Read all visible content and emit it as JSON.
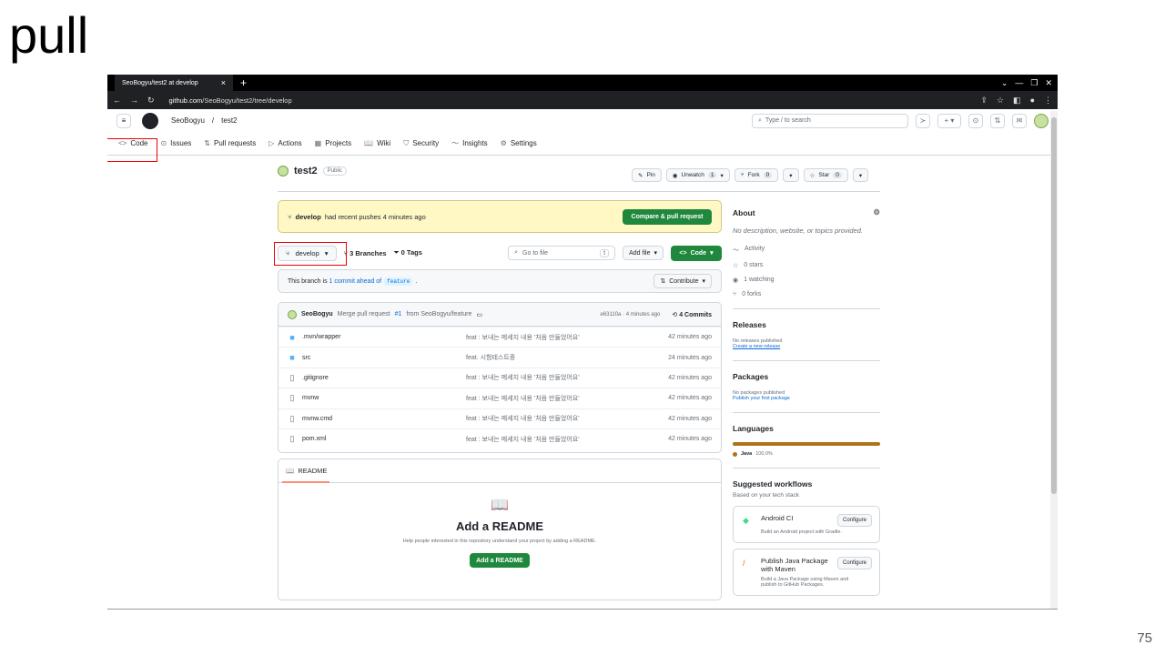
{
  "slide": {
    "title": "pull",
    "page": "75"
  },
  "browser": {
    "tab_title": "SeoBogyu/test2 at develop",
    "tab_close": "×",
    "new_tab": "+",
    "url_host": "github.com",
    "url_path": "/SeoBogyu/test2/tree/develop"
  },
  "header": {
    "owner": "SeoBogyu",
    "sep": "/",
    "repo": "test2",
    "search_placeholder": "Type / to search"
  },
  "tabs": [
    {
      "label": "Code",
      "icon": "<>"
    },
    {
      "label": "Issues",
      "icon": "⊙"
    },
    {
      "label": "Pull requests",
      "icon": "⇅"
    },
    {
      "label": "Actions",
      "icon": "▷"
    },
    {
      "label": "Projects",
      "icon": "▦"
    },
    {
      "label": "Wiki",
      "icon": "📖"
    },
    {
      "label": "Security",
      "icon": "⛉"
    },
    {
      "label": "Insights",
      "icon": "〜"
    },
    {
      "label": "Settings",
      "icon": "⚙"
    }
  ],
  "repo": {
    "name": "test2",
    "visibility": "Public",
    "pin": "Pin",
    "unwatch": "Unwatch",
    "unwatch_count": "1",
    "fork": "Fork",
    "fork_count": "0",
    "star": "Star",
    "star_count": "0"
  },
  "banner": {
    "branch": "develop",
    "text": "had recent pushes 4 minutes ago",
    "button": "Compare & pull request"
  },
  "toolbar": {
    "branch": "develop",
    "branches": "3 Branches",
    "tags": "0 Tags",
    "goto_placeholder": "Go to file",
    "goto_key": "t",
    "add_file": "Add file",
    "code": "Code"
  },
  "ahead": {
    "prefix": "This branch is",
    "link": "1 commit ahead of",
    "target": "feature",
    "suffix": ".",
    "contribute": "Contribute"
  },
  "commit": {
    "author": "SeoBogyu",
    "message": "Merge pull request",
    "pr": "#1",
    "from": "from SeoBogyu/feature",
    "hash": "e63110a · 4 minutes ago",
    "commits": "4 Commits"
  },
  "files": [
    {
      "type": "folder",
      "name": ".mvn/wrapper",
      "message": "feat : 보내는 메세지 내용 '처음 만들었어요'",
      "age": "42 minutes ago"
    },
    {
      "type": "folder",
      "name": "src",
      "message": "feat. 시험테스트중",
      "age": "24 minutes ago"
    },
    {
      "type": "file",
      "name": ".gitignore",
      "message": "feat : 보내는 메세지 내용 '처음 만들었어요'",
      "age": "42 minutes ago"
    },
    {
      "type": "file",
      "name": "mvnw",
      "message": "feat : 보내는 메세지 내용 '처음 만들었어요'",
      "age": "42 minutes ago"
    },
    {
      "type": "file",
      "name": "mvnw.cmd",
      "message": "feat : 보내는 메세지 내용 '처음 만들었어요'",
      "age": "42 minutes ago"
    },
    {
      "type": "file",
      "name": "pom.xml",
      "message": "feat : 보내는 메세지 내용 '처음 만들었어요'",
      "age": "42 minutes ago"
    }
  ],
  "readme": {
    "tab": "README",
    "title": "Add a README",
    "subtitle": "Help people interested in this repository understand your project by adding a README.",
    "button": "Add a README"
  },
  "sidebar": {
    "about": "About",
    "description": "No description, website, or topics provided.",
    "activity": "Activity",
    "stars": "0 stars",
    "watching": "1 watching",
    "forks": "0 forks",
    "releases": "Releases",
    "releases_none": "No releases published",
    "releases_link": "Create a new release",
    "packages": "Packages",
    "packages_none": "No packages published",
    "packages_link": "Publish your first package",
    "languages": "Languages",
    "lang_name": "Java",
    "lang_pct": "100.0%",
    "suggested": "Suggested workflows",
    "suggested_sub": "Based on your tech stack",
    "workflows": [
      {
        "title": "Android CI",
        "desc": "Build an Android project with Gradle.",
        "button": "Configure"
      },
      {
        "title": "Publish Java Package with Maven",
        "desc": "Build a Java Package using Maven and publish to GitHub Packages.",
        "button": "Configure"
      }
    ]
  }
}
